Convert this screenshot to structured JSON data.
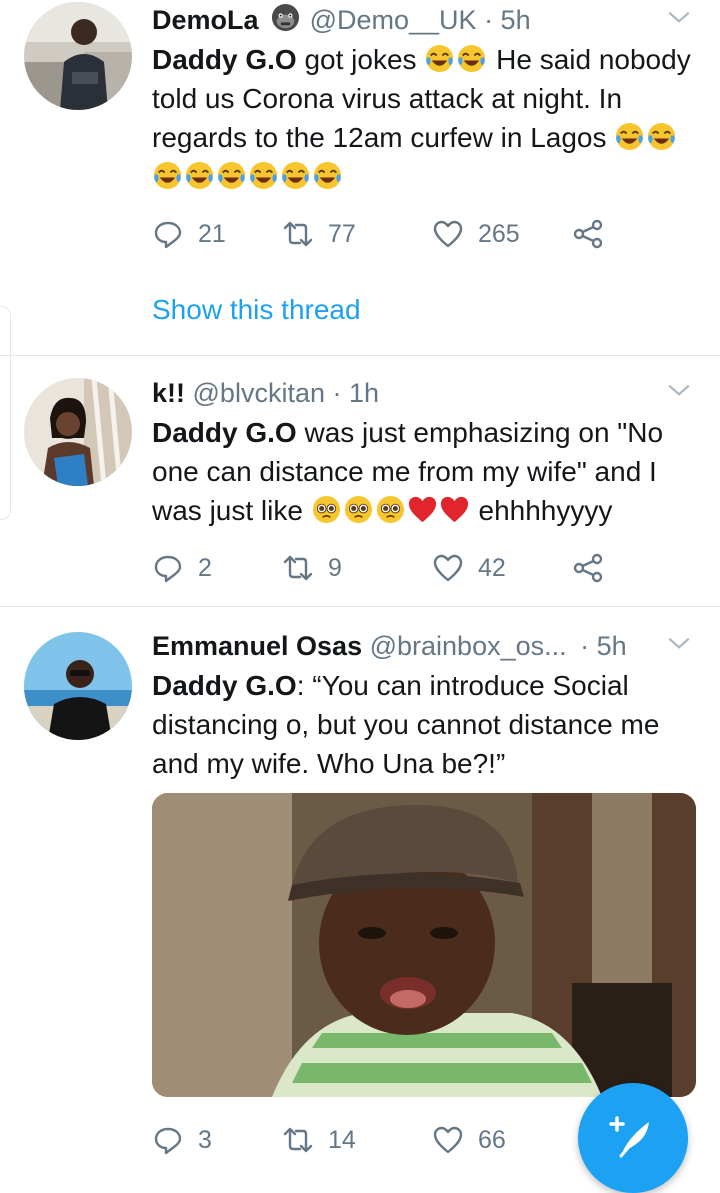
{
  "colors": {
    "accent": "#1da1f2",
    "muted": "#657786",
    "text": "#14171a",
    "divider": "#e1e8ed"
  },
  "tweets": [
    {
      "name": "DemoLa",
      "handle": "@Demo__UK",
      "time": "· 5h",
      "name_emoji": "gorilla-emoji",
      "text_bold": "Daddy G.O",
      "text_part1": " got jokes ",
      "text_part2": " He said nobody told us Corona virus attack at night. In regards to the 12am curfew in Lagos ",
      "replies": "21",
      "retweets": "77",
      "likes": "265",
      "show_thread": "Show this thread"
    },
    {
      "name": "k!!",
      "handle": "@blvckitan",
      "time": "· 1h",
      "text_bold": "Daddy G.O",
      "text_part1": " was just emphasizing on \"No one can distance me from my wife\" and I was just like ",
      "text_part2": " ehhhhyyyy",
      "replies": "2",
      "retweets": "9",
      "likes": "42"
    },
    {
      "name": "Emmanuel Osas",
      "handle": "@brainbox_os...",
      "time": "· 5h",
      "text_bold": "Daddy G.O",
      "text_part1": ": “You can introduce Social distancing o, but you cannot distance me and my wife. Who Una be?!”",
      "replies": "3",
      "retweets": "14",
      "likes": "66"
    }
  ],
  "compose_button": "compose-tweet-icon"
}
